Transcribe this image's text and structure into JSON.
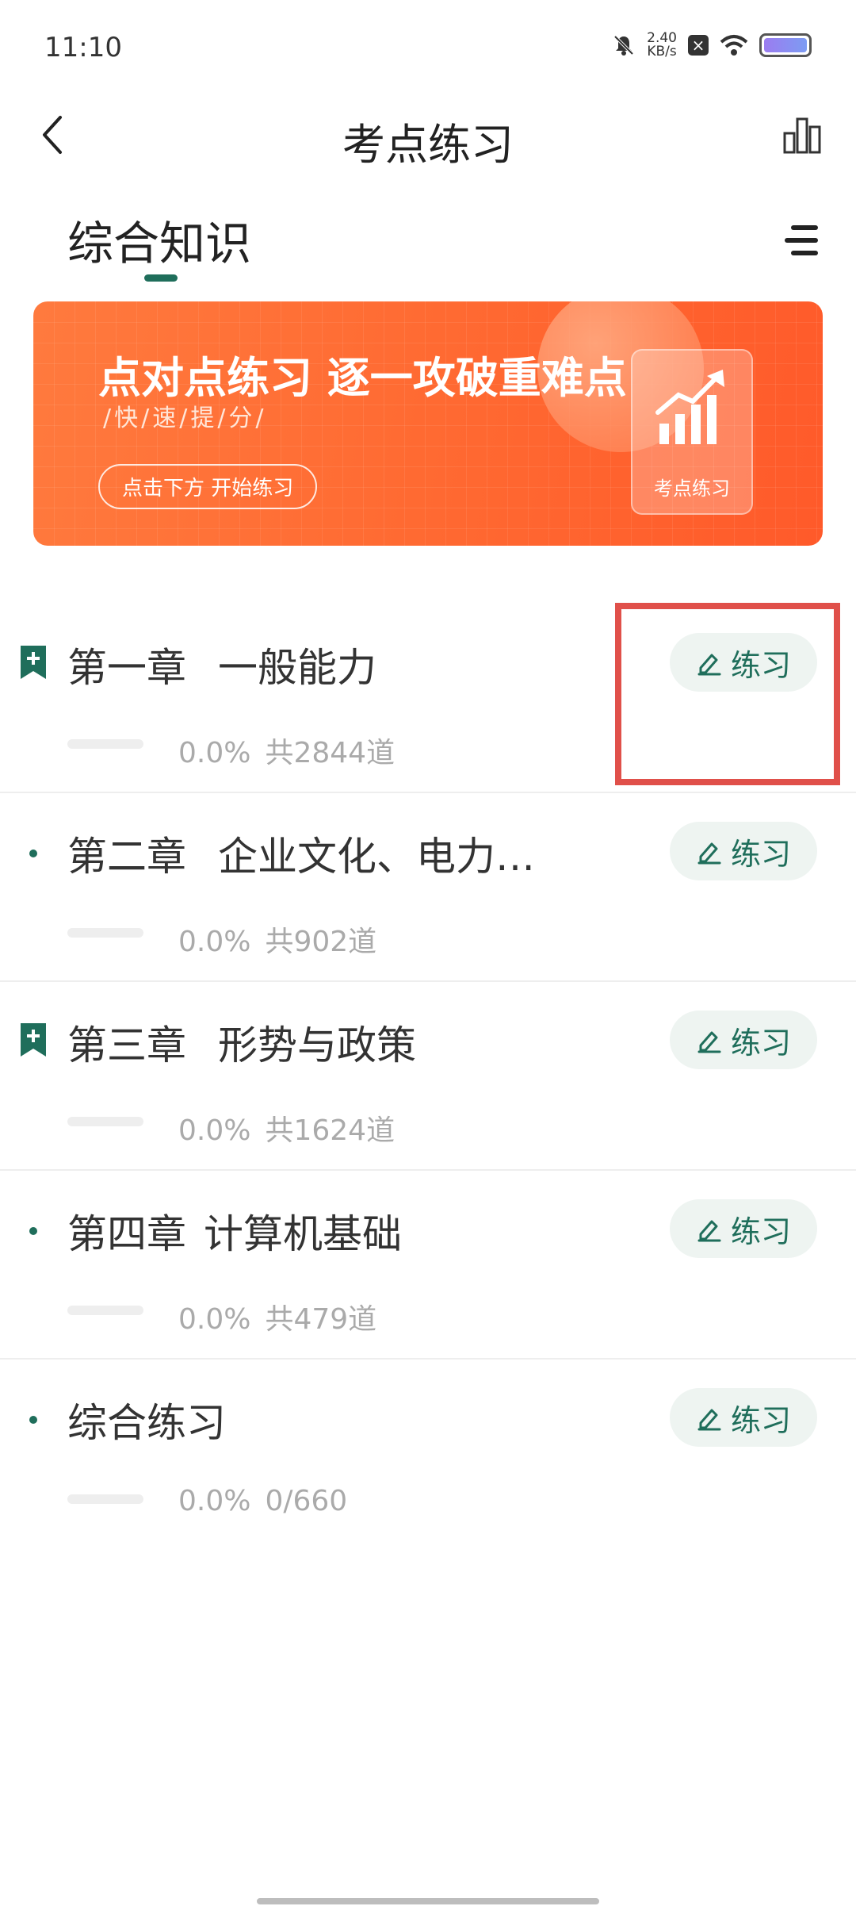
{
  "status_bar": {
    "time": "11:10",
    "net_speed_value": "2.40",
    "net_speed_unit": "KB/s",
    "icons": [
      "bell-off-icon",
      "close-badge-icon",
      "wifi-icon",
      "battery-icon"
    ]
  },
  "header": {
    "title": "考点练习"
  },
  "tabs": {
    "active_label": "综合知识"
  },
  "banner": {
    "headline": "点对点练习 逐一攻破重难点",
    "subtitle": "/快/速/提/分/",
    "cta": "点击下方 开始练习",
    "card_label": "考点练习"
  },
  "chapters": [
    {
      "prefix": "第一章",
      "name": "一般能力",
      "icon": "bookmark-plus-icon",
      "progress_text": "0.0%",
      "count_text": "共2844道",
      "progress": 0,
      "button_label": "练习"
    },
    {
      "prefix": "第二章",
      "name": "企业文化、电力…",
      "icon": "dot",
      "progress_text": "0.0%",
      "count_text": "共902道",
      "progress": 0,
      "button_label": "练习"
    },
    {
      "prefix": "第三章",
      "name": "形势与政策",
      "icon": "bookmark-plus-icon",
      "progress_text": "0.0%",
      "count_text": "共1624道",
      "progress": 0,
      "button_label": "练习"
    },
    {
      "prefix": "第四章",
      "name": "计算机基础",
      "icon": "dot",
      "progress_text": "0.0%",
      "count_text": "共479道",
      "progress": 0,
      "button_label": "练习"
    },
    {
      "prefix": "",
      "name": "综合练习",
      "icon": "dot",
      "progress_text": "0.0%",
      "count_text": "0/660",
      "progress": 0,
      "button_label": "练习"
    }
  ],
  "colors": {
    "accent": "#1f6e5b",
    "banner": "#ff6a32",
    "highlight": "#e0504a"
  }
}
